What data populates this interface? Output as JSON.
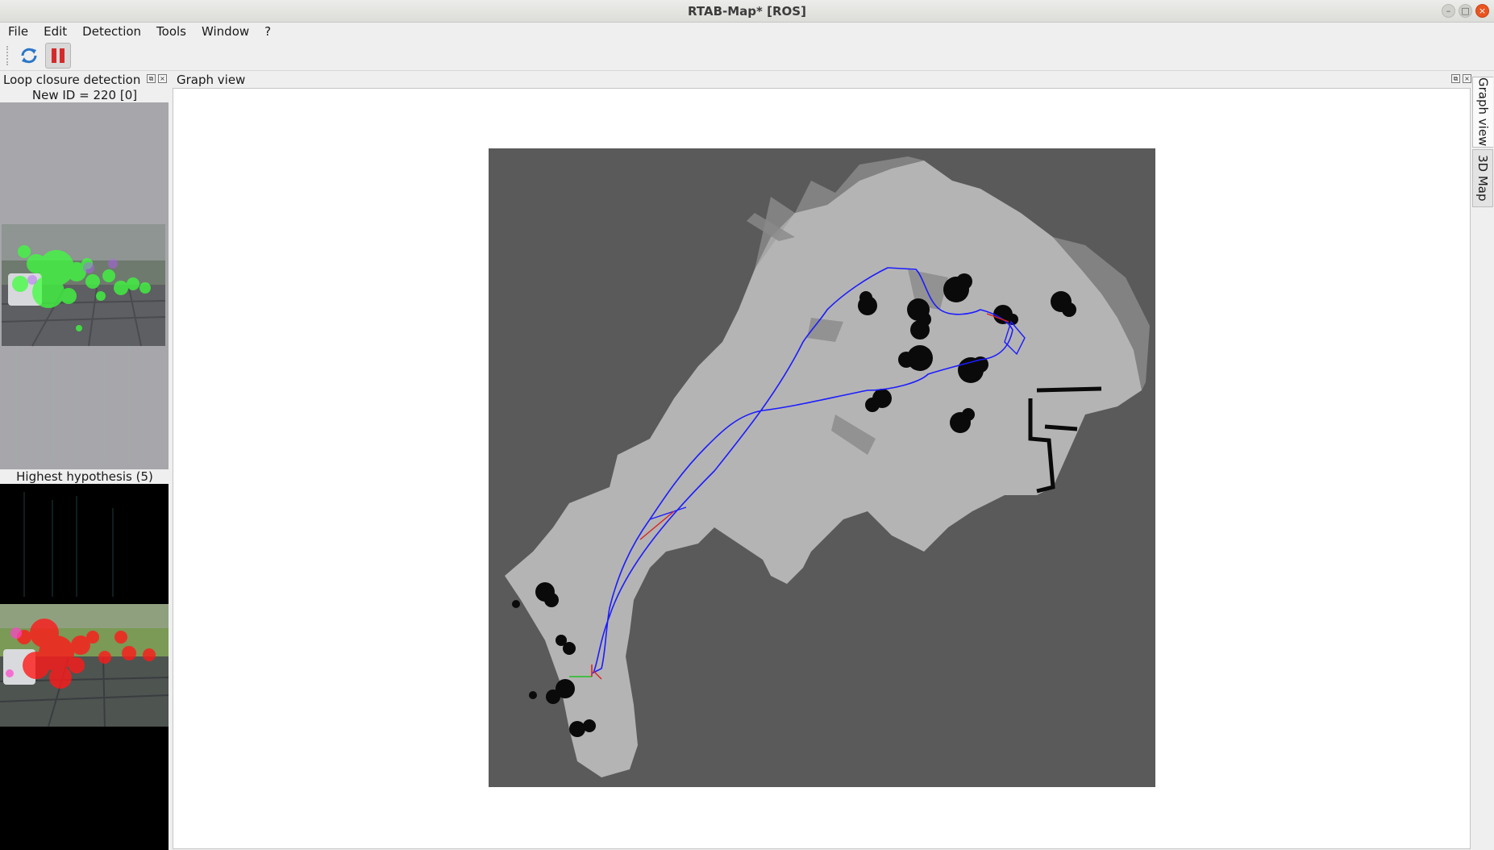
{
  "window": {
    "title": "RTAB-Map* [ROS]",
    "controls": [
      "minimize",
      "maximize",
      "close"
    ]
  },
  "menu": {
    "items": [
      "File",
      "Edit",
      "Detection",
      "Tools",
      "Window",
      "?"
    ]
  },
  "toolbar": {
    "buttons": [
      {
        "icon": "refresh-icon"
      },
      {
        "icon": "pause-icon"
      }
    ]
  },
  "loop_panel": {
    "title": "Loop closure detection",
    "new_id_label": "New ID = 220 [0]",
    "hypothesis_label": "Highest hypothesis (5)"
  },
  "graph_panel": {
    "title": "Graph view"
  },
  "right_tabs": {
    "items": [
      "Graph view",
      "3D Map"
    ],
    "active": "Graph view"
  },
  "colors": {
    "map_background": "#5a5a5a",
    "free_space": "#b4b4b4",
    "obstacle": "#000000",
    "trajectory": "#1c1cff",
    "loop_link": "#e02020",
    "odometry_axis_x": "#e02020",
    "odometry_axis_y": "#20c020",
    "keypoint_new": "#33ff33",
    "keypoint_loop": "#ff1a1a"
  }
}
